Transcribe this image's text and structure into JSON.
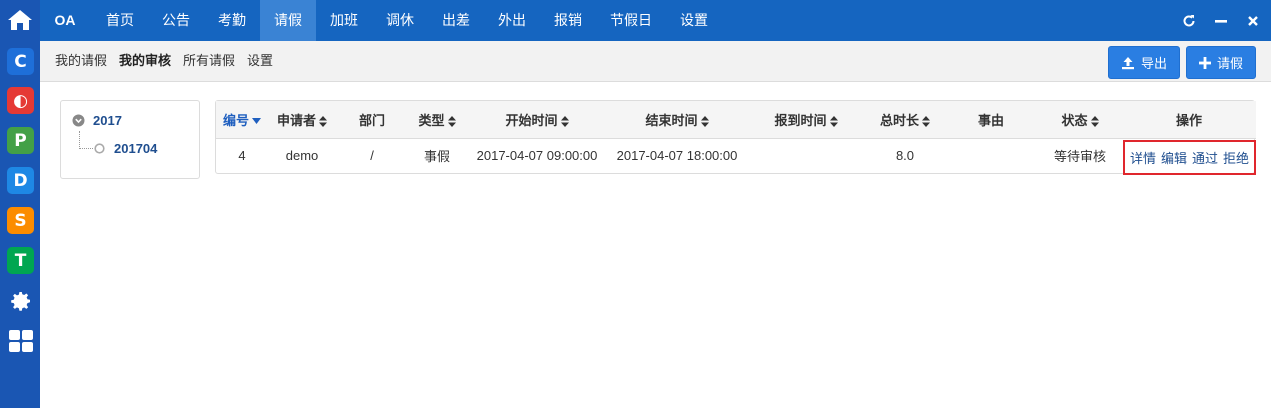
{
  "app": {
    "brand": "OA"
  },
  "rail": {
    "apps": [
      {
        "icon": "c-app-icon",
        "letter": "C",
        "color": "#1e6fd9"
      },
      {
        "icon": "o-app-icon",
        "letter": "◐",
        "color": "#e53935"
      },
      {
        "icon": "p-app-icon",
        "letter": "P",
        "color": "#43a047"
      },
      {
        "icon": "d-app-icon",
        "letter": "D",
        "color": "#1e88e5"
      },
      {
        "icon": "s-app-icon",
        "letter": "S",
        "color": "#fb8c00"
      },
      {
        "icon": "t-app-icon",
        "letter": "T",
        "color": "#00a651"
      }
    ]
  },
  "nav": {
    "items": [
      "首页",
      "公告",
      "考勤",
      "请假",
      "加班",
      "调休",
      "出差",
      "外出",
      "报销",
      "节假日",
      "设置"
    ],
    "active_index": 3
  },
  "subnav": {
    "links": [
      "我的请假",
      "我的审核",
      "所有请假",
      "设置"
    ],
    "active_index": 1,
    "export_label": "导出",
    "new_label": "请假"
  },
  "tree": {
    "year": "2017",
    "month": "201704"
  },
  "table": {
    "columns": [
      "编号",
      "申请者",
      "部门",
      "类型",
      "开始时间",
      "结束时间",
      "报到时间",
      "总时长",
      "事由",
      "状态",
      "操作"
    ],
    "rows": [
      {
        "id": "4",
        "applicant": "demo",
        "department": "/",
        "type": "事假",
        "start": "2017-04-07 09:00:00",
        "end": "2017-04-07 18:00:00",
        "report_time": "",
        "duration": "8.0",
        "reason": "",
        "status": "等待审核",
        "actions": [
          "详情",
          "编辑",
          "通过",
          "拒绝"
        ]
      }
    ]
  },
  "colors": {
    "nav_bg": "#1565c0",
    "rail_bg": "#1a56b3",
    "accent": "#2a7ee2",
    "highlight_border": "#e0262d"
  }
}
